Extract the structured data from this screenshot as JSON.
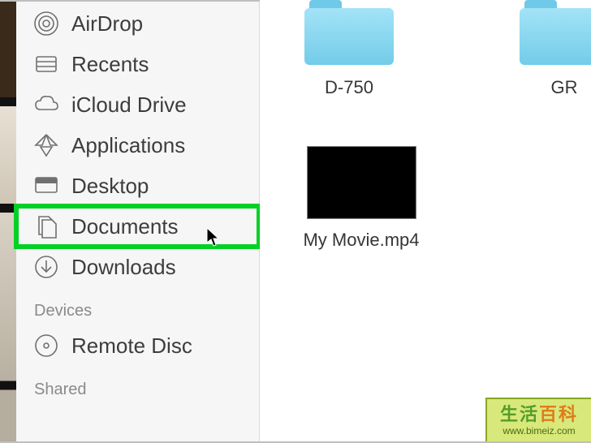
{
  "sidebar": {
    "items": [
      {
        "label": "AirDrop",
        "icon": "airdrop-icon"
      },
      {
        "label": "Recents",
        "icon": "recents-icon"
      },
      {
        "label": "iCloud Drive",
        "icon": "icloud-icon"
      },
      {
        "label": "Applications",
        "icon": "applications-icon"
      },
      {
        "label": "Desktop",
        "icon": "desktop-icon"
      },
      {
        "label": "Documents",
        "icon": "documents-icon",
        "highlighted": true
      },
      {
        "label": "Downloads",
        "icon": "downloads-icon"
      }
    ],
    "sections": [
      {
        "header": "Devices",
        "items": [
          {
            "label": "Remote Disc",
            "icon": "remote-disc-icon"
          }
        ]
      },
      {
        "header": "Shared",
        "items": []
      }
    ]
  },
  "content": {
    "folders": [
      {
        "name": "D-750"
      },
      {
        "name": "GR"
      }
    ],
    "files": [
      {
        "name": "My Movie.mp4",
        "type": "video"
      }
    ]
  },
  "watermark": {
    "cjk": "生活百科",
    "url": "www.bimeiz.com"
  },
  "colors": {
    "highlight": "#00d124",
    "folder_top": "#a3e3f7",
    "folder_bottom": "#73cce9"
  }
}
